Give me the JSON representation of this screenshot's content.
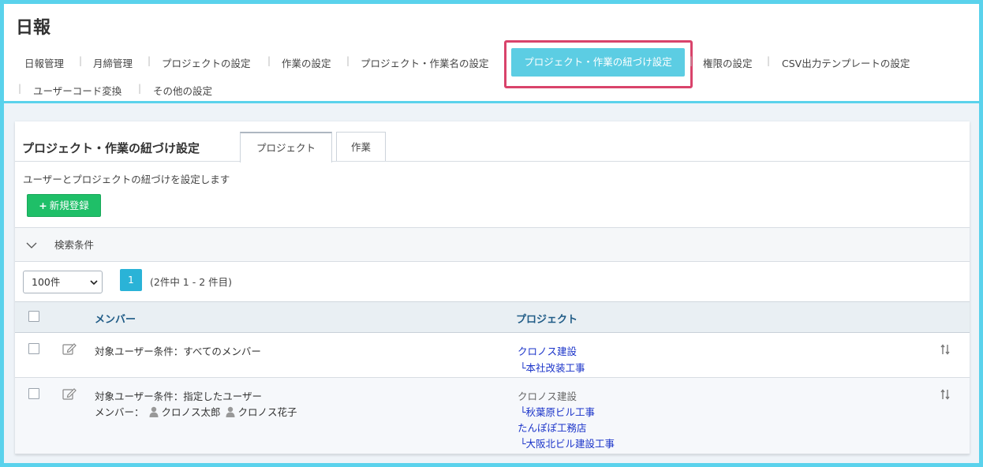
{
  "app": {
    "title": "日報"
  },
  "nav": {
    "items": [
      {
        "label": "日報管理"
      },
      {
        "label": "月締管理"
      },
      {
        "label": "プロジェクトの設定"
      },
      {
        "label": "作業の設定"
      },
      {
        "label": "プロジェクト・作業名の設定"
      },
      {
        "label": "プロジェクト・作業の紐づけ設定",
        "active": true
      },
      {
        "label": "権限の設定"
      },
      {
        "label": "CSV出力テンプレートの設定"
      },
      {
        "label": "ユーザーコード変換"
      },
      {
        "label": "その他の設定"
      }
    ],
    "separator": "|"
  },
  "panel": {
    "title": "プロジェクト・作業の紐づけ設定",
    "tabs": [
      {
        "label": "プロジェクト",
        "active": true
      },
      {
        "label": "作業",
        "active": false
      }
    ],
    "description": "ユーザーとプロジェクトの紐づけを設定します",
    "new_button": "新規登録",
    "new_button_icon": "+",
    "search_label": "検索条件",
    "page_size": "100件",
    "current_page": "1",
    "page_info": "(2件中 1 - 2 件目)"
  },
  "table": {
    "headers": {
      "member": "メンバー",
      "project": "プロジェクト"
    },
    "rows": [
      {
        "member_condition": "対象ユーザー条件：すべてのメンバー",
        "projects": [
          {
            "text": "クロノス建設",
            "link": true
          },
          {
            "text": "└本社改装工事",
            "link": true
          }
        ]
      },
      {
        "member_condition": "対象ユーザー条件：指定したユーザー",
        "member_label": "メンバー：",
        "members": [
          "クロノス太郎",
          "クロノス花子"
        ],
        "projects": [
          {
            "text": "クロノス建設",
            "link": false
          },
          {
            "text": "└秋葉原ビル工事",
            "link": true
          },
          {
            "text": "たんぽぽ工務店",
            "link": true
          },
          {
            "text": "└大阪北ビル建設工事",
            "link": true
          }
        ]
      }
    ]
  },
  "colors": {
    "accent": "#5ccde3",
    "highlight_border": "#d9436b",
    "success": "#1fbf68",
    "link": "#1a33c9",
    "header_text": "#1f5b86"
  }
}
